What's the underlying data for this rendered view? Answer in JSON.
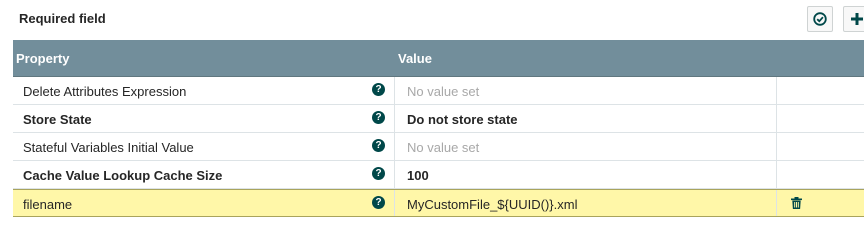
{
  "header": {
    "required_field_label": "Required field",
    "verify_icon": "check-circle-icon",
    "add_icon": "plus-icon"
  },
  "table": {
    "columns": {
      "property": "Property",
      "value": "Value"
    },
    "rows": [
      {
        "name": "Delete Attributes Expression",
        "value": "No value set",
        "value_set": false,
        "required": false,
        "selected": false
      },
      {
        "name": "Store State",
        "value": "Do not store state",
        "value_set": true,
        "required": true,
        "selected": false
      },
      {
        "name": "Stateful Variables Initial Value",
        "value": "No value set",
        "value_set": false,
        "required": false,
        "selected": false
      },
      {
        "name": "Cache Value Lookup Cache Size",
        "value": "100",
        "value_set": true,
        "required": true,
        "selected": false
      },
      {
        "name": "filename",
        "value": "MyCustomFile_${UUID()}.xml",
        "value_set": true,
        "required": false,
        "selected": true
      }
    ],
    "help_icon": "question-circle-icon",
    "delete_icon": "trash-icon"
  },
  "colors": {
    "header_bg": "#728e9b",
    "selected_row_bg": "#fff7a8",
    "help_icon": "#004849",
    "unset_text": "#a8a8a8"
  }
}
